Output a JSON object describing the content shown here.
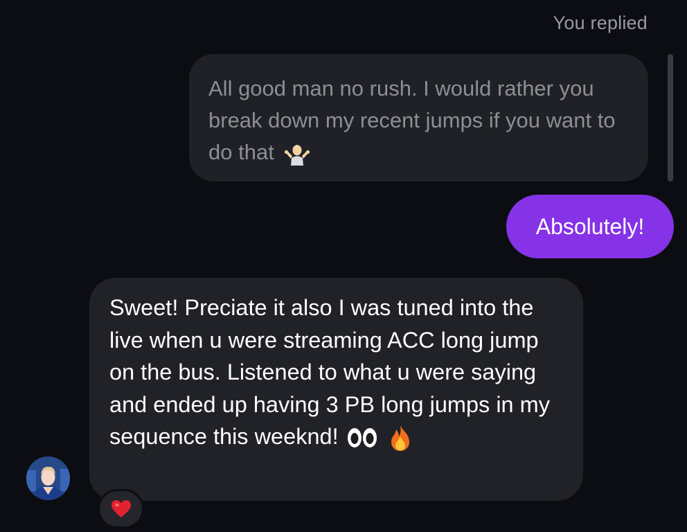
{
  "thread": {
    "reply_label": "You replied",
    "quoted_message": {
      "text": "All good man no rush. I would rather you break down my recent jumps if you want to do that",
      "emoji": "person-shrugging-emoji"
    },
    "sent_message": {
      "text": "Absolutely!",
      "color": "#8632e6"
    },
    "received_message": {
      "text": "Sweet! Preciate it also I was tuned into the live when u were streaming ACC long jump on the bus. Listened to what u were saying and ended up having 3 PB long jumps in my sequence this weeknd!",
      "emojis": [
        "eyes-emoji",
        "fire-emoji"
      ]
    },
    "sender_avatar": "avatar-photo",
    "reaction": {
      "emoji": "red-heart-emoji",
      "color": "#e0232e"
    }
  },
  "colors": {
    "background": "#0c0d12",
    "quoted_bubble": "#1f2126",
    "received_bubble": "#212227",
    "muted_text": "#8e8f95"
  }
}
